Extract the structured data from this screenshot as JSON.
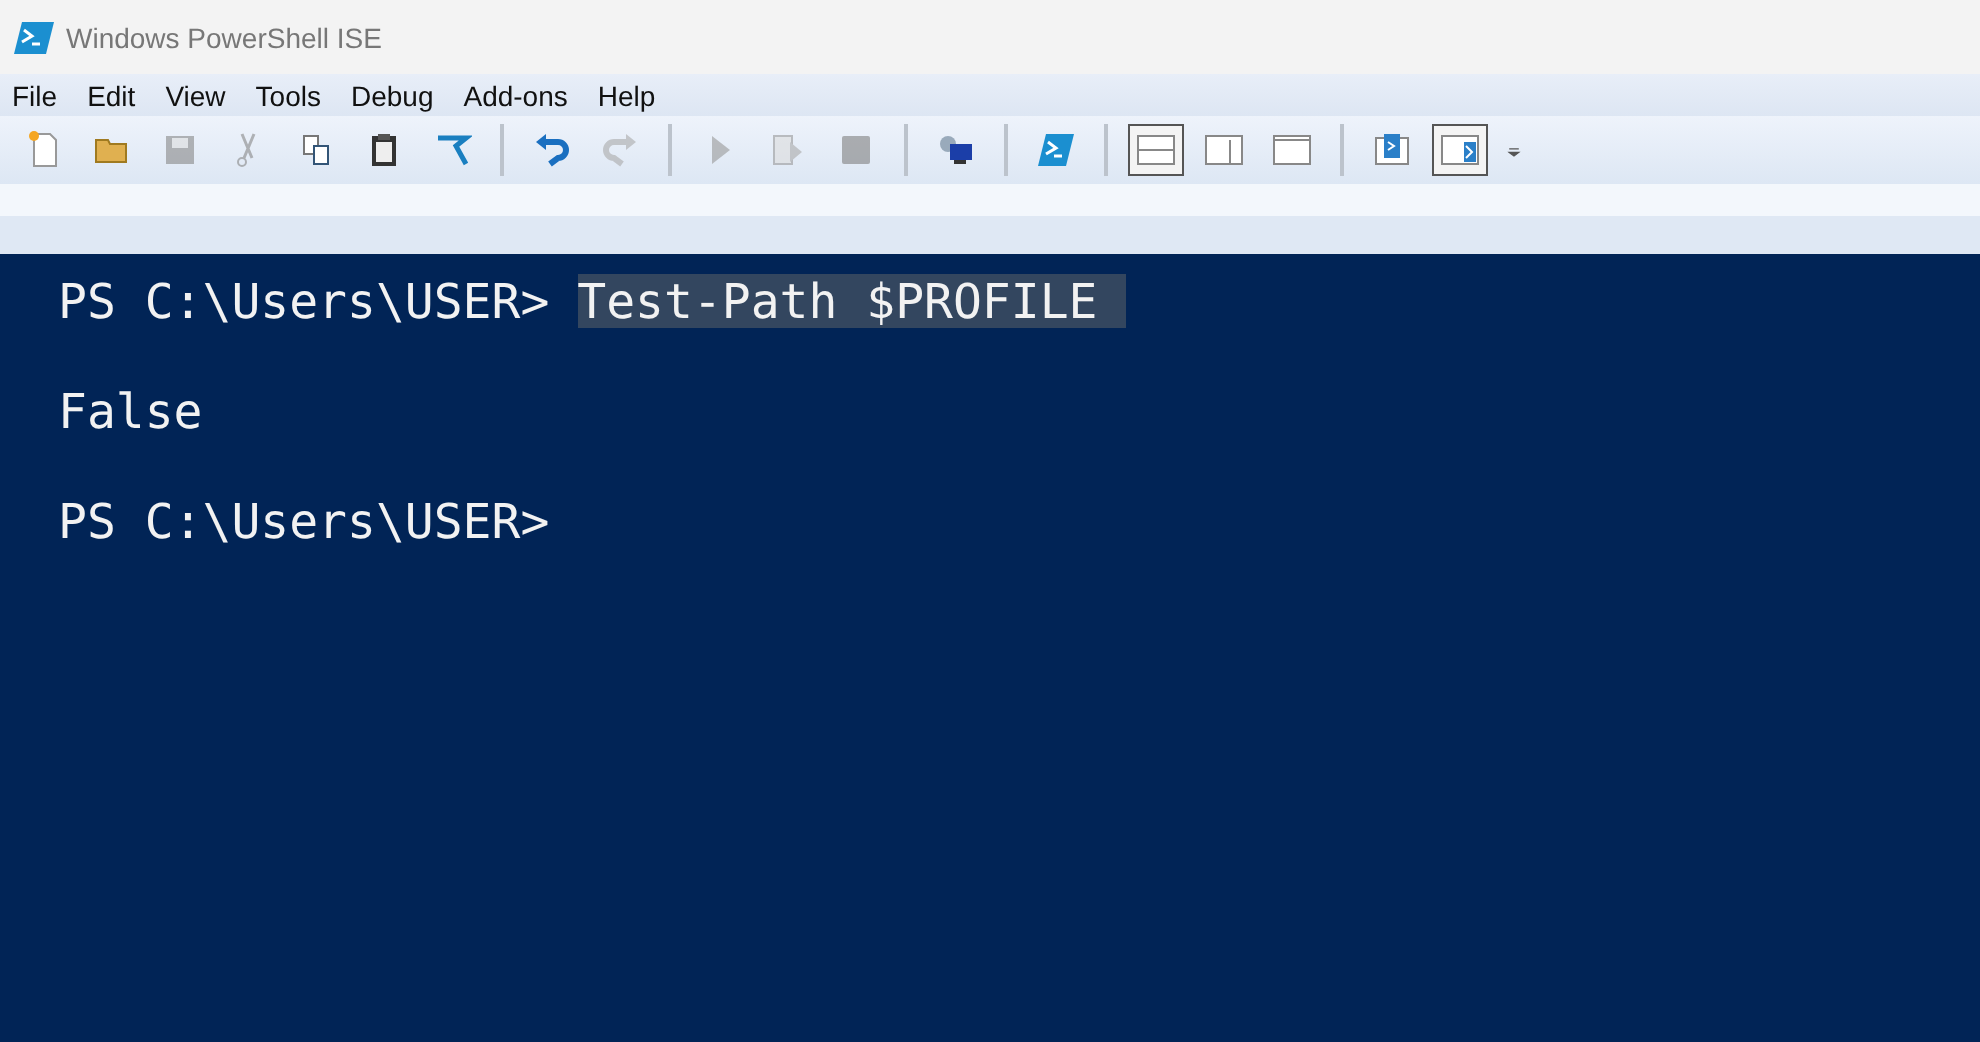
{
  "window": {
    "title": "Windows PowerShell ISE"
  },
  "menu": [
    "File",
    "Edit",
    "View",
    "Tools",
    "Debug",
    "Add-ons",
    "Help"
  ],
  "toolbar": [
    {
      "kind": "new",
      "disabled": false,
      "selected": false
    },
    {
      "kind": "open",
      "disabled": false,
      "selected": false
    },
    {
      "kind": "save",
      "disabled": true,
      "selected": false
    },
    {
      "kind": "cut",
      "disabled": true,
      "selected": false
    },
    {
      "kind": "copy",
      "disabled": false,
      "selected": false
    },
    {
      "kind": "paste",
      "disabled": false,
      "selected": false
    },
    {
      "kind": "clear",
      "disabled": false,
      "selected": false
    },
    {
      "kind": "sep"
    },
    {
      "kind": "undo",
      "disabled": false,
      "selected": false
    },
    {
      "kind": "redo",
      "disabled": true,
      "selected": false
    },
    {
      "kind": "sep"
    },
    {
      "kind": "run",
      "disabled": true,
      "selected": false
    },
    {
      "kind": "runsel",
      "disabled": true,
      "selected": false
    },
    {
      "kind": "stop",
      "disabled": true,
      "selected": false
    },
    {
      "kind": "sep"
    },
    {
      "kind": "remote",
      "disabled": false,
      "selected": false
    },
    {
      "kind": "sep"
    },
    {
      "kind": "shell",
      "disabled": false,
      "selected": false
    },
    {
      "kind": "sep"
    },
    {
      "kind": "layout-top",
      "disabled": false,
      "selected": true
    },
    {
      "kind": "layout-right",
      "disabled": false,
      "selected": false
    },
    {
      "kind": "layout-max",
      "disabled": false,
      "selected": false
    },
    {
      "kind": "sep"
    },
    {
      "kind": "script-top",
      "disabled": false,
      "selected": false
    },
    {
      "kind": "script-right",
      "disabled": false,
      "selected": true
    },
    {
      "kind": "more",
      "disabled": false,
      "selected": false
    }
  ],
  "console": [
    {
      "kind": "prompt",
      "prompt": "PS C:\\Users\\USER>",
      "command": "Test-Path $PROFILE",
      "selected": true
    },
    {
      "kind": "output",
      "text": "False"
    },
    {
      "kind": "prompt",
      "prompt": "PS C:\\Users\\USER>"
    }
  ]
}
